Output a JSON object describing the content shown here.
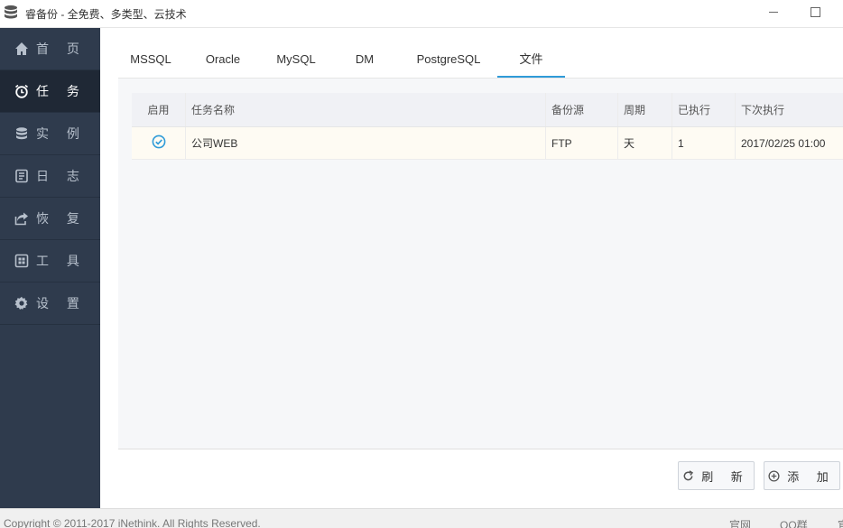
{
  "window": {
    "title": "睿备份 - 全免费、多类型、云技术",
    "icon": "database-icon"
  },
  "sidebar": {
    "items": [
      {
        "label": "首 页",
        "icon": "home-icon",
        "active": false
      },
      {
        "label": "任 务",
        "icon": "alarm-clock-icon",
        "active": true
      },
      {
        "label": "实 例",
        "icon": "database-icon",
        "active": false
      },
      {
        "label": "日 志",
        "icon": "log-icon",
        "active": false
      },
      {
        "label": "恢 复",
        "icon": "share-icon",
        "active": false
      },
      {
        "label": "工 具",
        "icon": "toolbox-icon",
        "active": false
      },
      {
        "label": "设 置",
        "icon": "gear-icon",
        "active": false
      }
    ]
  },
  "tabs": [
    {
      "label": "MSSQL",
      "active": false
    },
    {
      "label": "Oracle",
      "active": false
    },
    {
      "label": "MySQL",
      "active": false
    },
    {
      "label": "DM",
      "active": false
    },
    {
      "label": "PostgreSQL",
      "active": false
    },
    {
      "label": "文件",
      "active": true
    }
  ],
  "table": {
    "columns": [
      "启用",
      "任务名称",
      "备份源",
      "周期",
      "已执行",
      "下次执行"
    ],
    "rows": [
      {
        "enabled": true,
        "name": "公司WEB",
        "source": "FTP",
        "period": "天",
        "executed": "1",
        "next_run": "2017/02/25 01:00"
      }
    ]
  },
  "buttons": {
    "refresh": "刷 新",
    "add": "添 加"
  },
  "statusbar": {
    "copyright": "Copyright © 2011-2017 iNethink. All Rights Reserved.",
    "site_link": "官网",
    "qq_link": "QQ群",
    "more_link": "官"
  },
  "colors": {
    "sidebar_bg": "#2f3b4d",
    "sidebar_active": "#1f2835",
    "accent": "#2f9bd8",
    "row_bg": "#fefbf3"
  }
}
